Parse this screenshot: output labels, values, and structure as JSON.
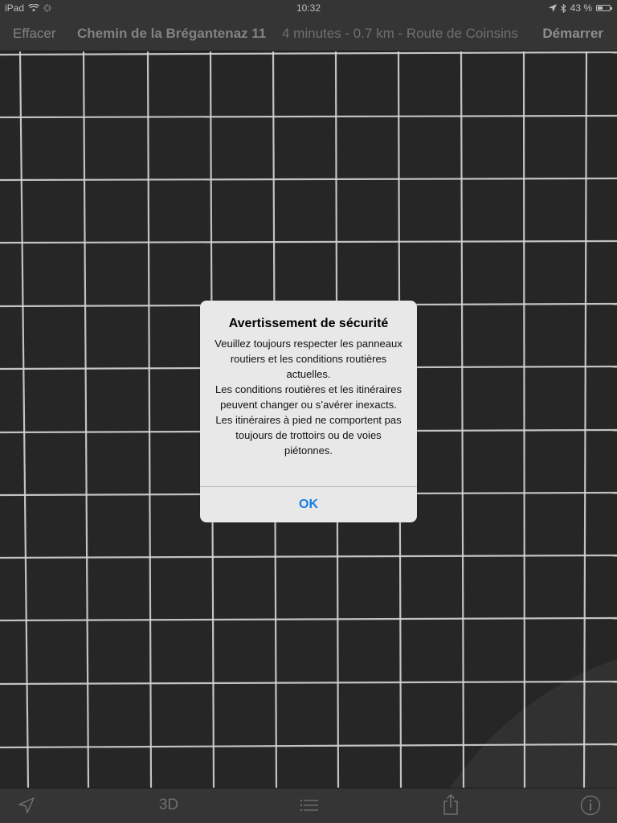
{
  "status_bar": {
    "device": "iPad",
    "time": "10:32",
    "battery": "43 %",
    "battery_level": 0.43
  },
  "nav": {
    "clear_label": "Effacer",
    "destination": "Chemin de la Brégantenaz 11",
    "route_summary": "4 minutes - 0.7 km - Route de Coinsins",
    "start_label": "Démarrer"
  },
  "toolbar": {
    "three_d_label": "3D"
  },
  "alert": {
    "title": "Avertissement de sécurité",
    "paragraphs": [
      "Veuillez toujours respecter les panneaux routiers et les conditions routières actuelles.",
      "Les conditions routières et les itinéraires peuvent changer ou s’avérer inexacts.",
      "Les itinéraires à pied ne comportent pas toujours de trottoirs ou de voies piétonnes."
    ],
    "ok_label": "OK"
  },
  "colors": {
    "accent": "#1a7fe6",
    "map_background": "#2a2a2a",
    "grid_line": "#e6e6e6"
  }
}
